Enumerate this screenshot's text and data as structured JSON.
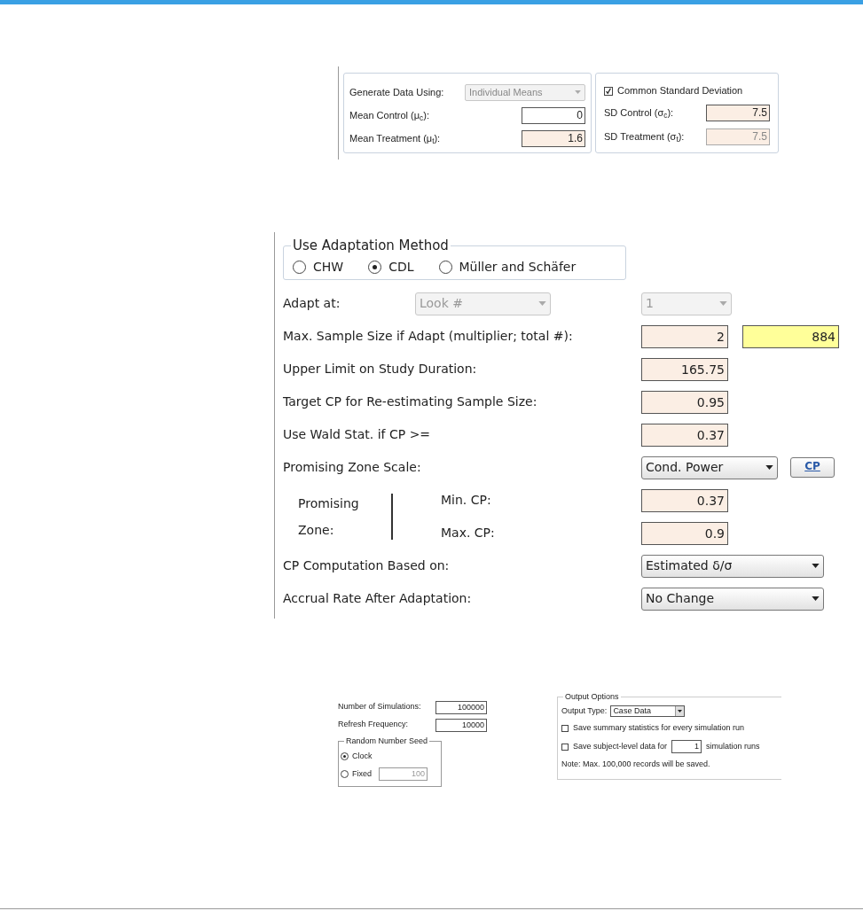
{
  "panel_1": {
    "generate": {
      "label": "Generate Data Using:",
      "value": "Individual Means",
      "disabled": true
    },
    "means": [
      {
        "label": "Mean Control (μ$_{c}$):",
        "value": "0",
        "highlighted": false
      },
      {
        "label": "Mean Treatment (μ$_{t}$):",
        "value": "1.6",
        "highlighted": true
      }
    ],
    "common_sd": {
      "label": "Common Standard Deviation",
      "checked": true
    },
    "sds": [
      {
        "label": "SD Control (σ$_{c}$):",
        "value": "7.5",
        "disabled": false
      },
      {
        "label": "SD Treatment (σ$_{t}$):",
        "value": "7.5",
        "disabled": true
      }
    ]
  },
  "panel_2": {
    "adaptation_method": {
      "legend": "Use Adaptation Method",
      "options": [
        {
          "label": "CHW",
          "selected": false
        },
        {
          "label": "CDL",
          "selected": true
        },
        {
          "label": "Müller and Schäfer",
          "selected": false
        }
      ]
    },
    "rows": [
      {
        "kind": "selects",
        "label": "Adapt at:",
        "fields": [
          {
            "value": "Look #",
            "disabled": true
          },
          {
            "value": "1",
            "disabled": true
          }
        ]
      },
      {
        "kind": "inputs",
        "label": "Max. Sample Size if Adapt (multiplier; total #):",
        "fields": [
          {
            "value": "2",
            "computed": false
          },
          {
            "value": "884",
            "computed": true
          }
        ]
      },
      {
        "kind": "inputs",
        "label": "Upper Limit on Study Duration:",
        "fields": [
          {
            "value": "165.75",
            "computed": false
          }
        ]
      },
      {
        "kind": "inputs",
        "label": "Target CP for Re-estimating Sample Size:",
        "fields": [
          {
            "value": "0.95",
            "computed": false
          }
        ]
      },
      {
        "kind": "inputs",
        "label": "Use Wald Stat. if CP >=",
        "fields": [
          {
            "value": "0.37",
            "computed": false
          }
        ]
      },
      {
        "kind": "select_button",
        "label": "Promising Zone Scale:",
        "value": "Cond. Power",
        "button": "CP"
      },
      {
        "kind": "zone",
        "label": "Promising Zone:",
        "bounds": [
          {
            "label": "Min. CP:",
            "value": "0.37"
          },
          {
            "label": "Max. CP:",
            "value": "0.9"
          }
        ]
      },
      {
        "kind": "select",
        "label": "CP Computation Based on:",
        "value": "Estimated δ/σ"
      },
      {
        "kind": "select",
        "label": "Accrual Rate After Adaptation:",
        "value": "No Change"
      }
    ]
  },
  "panel_3": {
    "simulations": [
      {
        "label": "Number of Simulations:",
        "value": "100000"
      },
      {
        "label": "Refresh Frequency:",
        "value": "10000"
      }
    ],
    "seed": {
      "legend": "Random Number Seed",
      "options": [
        {
          "label": "Clock",
          "selected": true
        },
        {
          "label": "Fixed",
          "selected": false,
          "value": "100"
        }
      ]
    },
    "output": {
      "legend": "Output Options",
      "type_label": "Output Type:",
      "type_value": "Case Data",
      "save_summary": {
        "label": "Save summary statistics for every simulation run",
        "checked": false
      },
      "save_subject": {
        "label_before": "Save subject-level data for",
        "value": "1",
        "label_after": "simulation runs",
        "checked": false
      },
      "note": "Note: Max. 100,000 records will be saved."
    }
  }
}
